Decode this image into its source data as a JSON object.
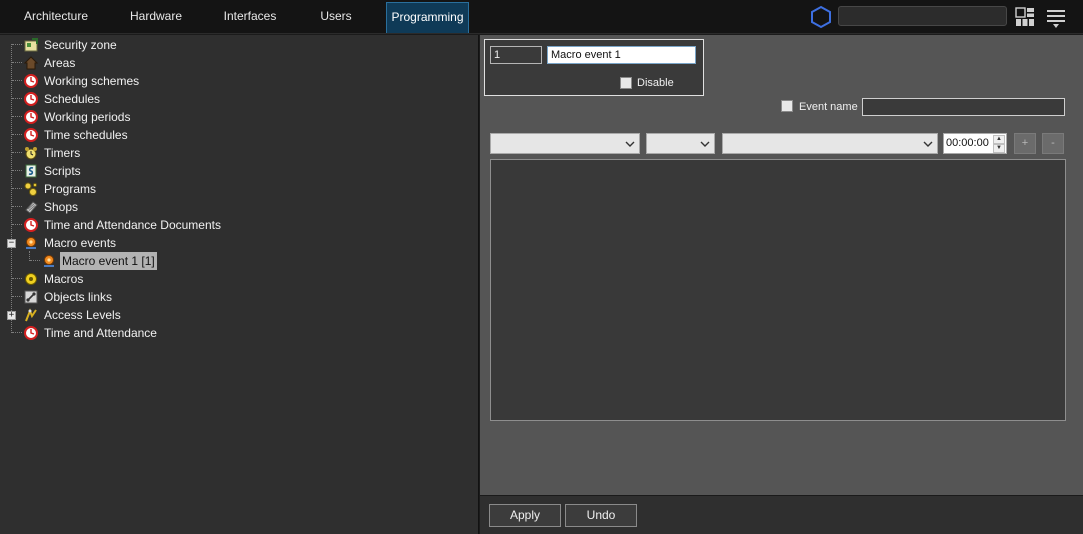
{
  "tabs": [
    {
      "label": "Architecture"
    },
    {
      "label": "Hardware"
    },
    {
      "label": "Interfaces"
    },
    {
      "label": "Users"
    },
    {
      "label": "Programming"
    }
  ],
  "active_tab": "Programming",
  "header": {
    "search_value": "",
    "icons": [
      "hexagon-icon",
      "layout-grid-icon",
      "menu-icon"
    ]
  },
  "tree": {
    "items": [
      {
        "label": "Security zone",
        "icon": "security-zone-icon"
      },
      {
        "label": "Areas",
        "icon": "areas-icon"
      },
      {
        "label": "Working schemes",
        "icon": "clock-icon"
      },
      {
        "label": "Schedules",
        "icon": "clock-icon"
      },
      {
        "label": "Working periods",
        "icon": "clock-icon"
      },
      {
        "label": "Time schedules",
        "icon": "clock-icon"
      },
      {
        "label": "Timers",
        "icon": "timer-icon"
      },
      {
        "label": "Scripts",
        "icon": "script-icon"
      },
      {
        "label": "Programs",
        "icon": "program-icon"
      },
      {
        "label": "Shops",
        "icon": "shop-icon"
      },
      {
        "label": "Time and Attendance Documents",
        "icon": "clock-icon"
      },
      {
        "label": "Macro events",
        "icon": "macro-event-icon",
        "expanded": true
      },
      {
        "label": "Macro event 1 [1]",
        "icon": "macro-event-icon",
        "selected": true,
        "child": true
      },
      {
        "label": "Macros",
        "icon": "macro-icon"
      },
      {
        "label": "Objects links",
        "icon": "link-icon"
      },
      {
        "label": "Access Levels",
        "icon": "access-level-icon",
        "expanded": false
      },
      {
        "label": "Time and Attendance",
        "icon": "clock-icon"
      }
    ]
  },
  "props": {
    "id_value": "1",
    "name_value": "Macro event 1",
    "disable_label": "Disable",
    "disable_checked": false,
    "event_name_label": "Event name",
    "event_name_checked": false,
    "event_name_value": "",
    "combo1_value": "",
    "combo2_value": "",
    "combo3_value": "",
    "time_value": "00:00:00",
    "add_label": "+",
    "remove_label": "-"
  },
  "footer": {
    "apply_label": "Apply",
    "undo_label": "Undo"
  },
  "colors": {
    "active_tab_bg": "#0f3a57",
    "tree_bg": "#2f2f2f",
    "props_bg": "#555555",
    "clock_red": "#d21f1f"
  }
}
